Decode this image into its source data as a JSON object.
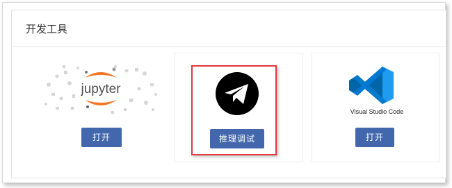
{
  "section": {
    "title": "开发工具"
  },
  "cards": [
    {
      "logo_text": "jupyter",
      "button_label": "打开"
    },
    {
      "logo_icon": "paper-plane-icon",
      "button_label": "推理调试"
    },
    {
      "logo_icon": "vscode-icon",
      "logo_caption": "Visual Studio Code",
      "button_label": "打开"
    }
  ],
  "colors": {
    "button_bg": "#4267ad",
    "highlight_border": "#e0393e",
    "jupyter_orange": "#f37726",
    "vscode_blue": "#0078d4"
  }
}
